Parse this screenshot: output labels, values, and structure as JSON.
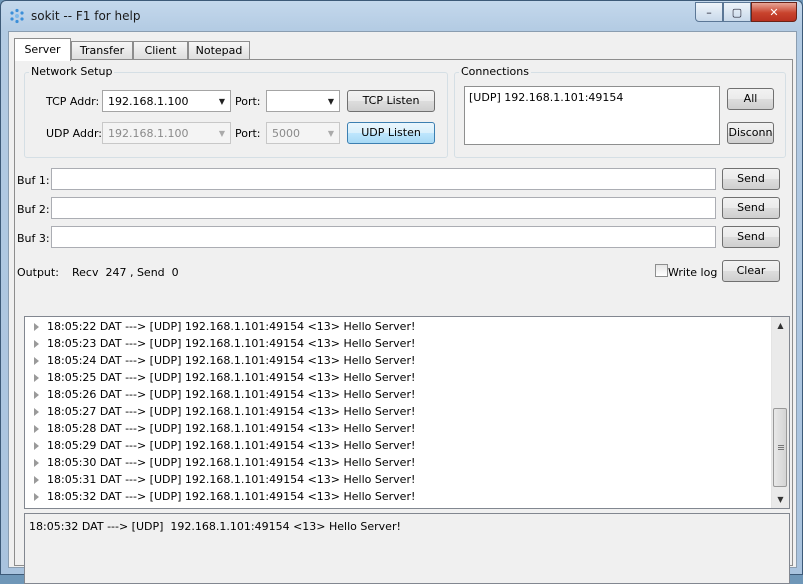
{
  "window": {
    "title": "sokit -- F1 for help",
    "min": "–",
    "max": "▢",
    "close": "✕"
  },
  "tabs": [
    "Server",
    "Transfer",
    "Client",
    "Notepad"
  ],
  "network_setup": {
    "label": "Network Setup",
    "tcp_addr_label": "TCP Addr:",
    "tcp_addr_value": "192.168.1.100",
    "tcp_port_label": "Port:",
    "tcp_port_value": "",
    "tcp_listen": "TCP Listen",
    "udp_addr_label": "UDP Addr:",
    "udp_addr_value": "192.168.1.100",
    "udp_port_label": "Port:",
    "udp_port_value": "5000",
    "udp_listen": "UDP Listen"
  },
  "connections": {
    "label": "Connections",
    "items": [
      "[UDP] 192.168.1.101:49154"
    ],
    "all_button": "All",
    "disconn_button": "Disconn"
  },
  "buffers": {
    "buf1_label": "Buf 1:",
    "buf2_label": "Buf 2:",
    "buf3_label": "Buf 3:",
    "send": "Send"
  },
  "output": {
    "label": "Output:",
    "stats": "Recv  247 , Send  0",
    "write_log": "Write log",
    "clear": "Clear"
  },
  "log": [
    "18:05:22 DAT ---> [UDP] 192.168.1.101:49154 <13> Hello Server!",
    "18:05:23 DAT ---> [UDP] 192.168.1.101:49154 <13> Hello Server!",
    "18:05:24 DAT ---> [UDP] 192.168.1.101:49154 <13> Hello Server!",
    "18:05:25 DAT ---> [UDP] 192.168.1.101:49154 <13> Hello Server!",
    "18:05:26 DAT ---> [UDP] 192.168.1.101:49154 <13> Hello Server!",
    "18:05:27 DAT ---> [UDP] 192.168.1.101:49154 <13> Hello Server!",
    "18:05:28 DAT ---> [UDP] 192.168.1.101:49154 <13> Hello Server!",
    "18:05:29 DAT ---> [UDP] 192.168.1.101:49154 <13> Hello Server!",
    "18:05:30 DAT ---> [UDP] 192.168.1.101:49154 <13> Hello Server!",
    "18:05:31 DAT ---> [UDP] 192.168.1.101:49154 <13> Hello Server!",
    "18:05:32 DAT ---> [UDP] 192.168.1.101:49154 <13> Hello Server!"
  ],
  "detail": "18:05:32 DAT ---> [UDP]  192.168.1.101:49154 <13> Hello Server!"
}
